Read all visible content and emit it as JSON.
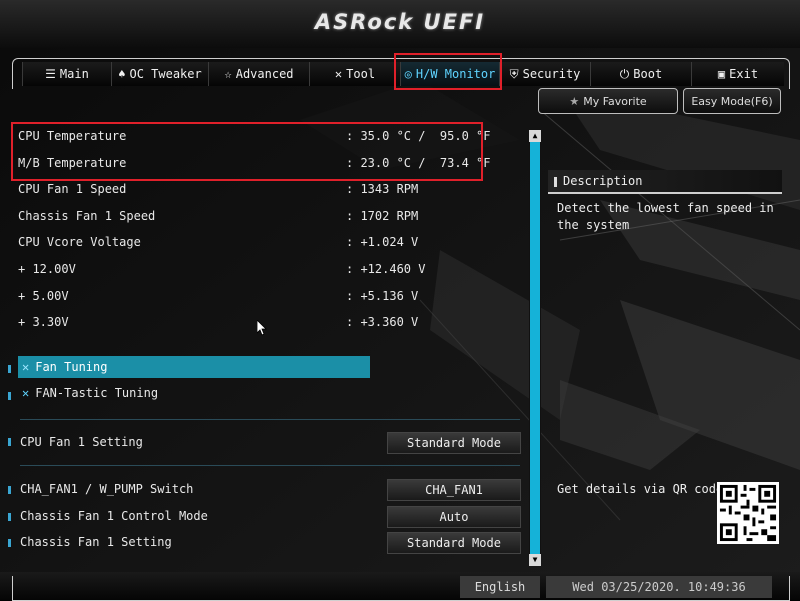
{
  "header": {
    "title": "ASRock UEFI"
  },
  "tabs": [
    {
      "label": "Main",
      "icon": "list-icon",
      "glyph": "☰"
    },
    {
      "label": "OC Tweaker",
      "icon": "flame-icon",
      "glyph": "♠"
    },
    {
      "label": "Advanced",
      "icon": "star-icon",
      "glyph": "☆"
    },
    {
      "label": "Tool",
      "icon": "tool-icon",
      "glyph": "✕"
    },
    {
      "label": "H/W Monitor",
      "icon": "monitor-icon",
      "glyph": "◎"
    },
    {
      "label": "Security",
      "icon": "shield-icon",
      "glyph": "⛨"
    },
    {
      "label": "Boot",
      "icon": "power-icon",
      "glyph": "⏻"
    },
    {
      "label": "Exit",
      "icon": "exit-icon",
      "glyph": "▣"
    }
  ],
  "buttons": {
    "favorite": "My Favorite",
    "easy_mode": "Easy Mode(F6)"
  },
  "readings": [
    {
      "label": "CPU Temperature",
      "value": ": 35.0 °C /  95.0 °F"
    },
    {
      "label": "M/B Temperature",
      "value": ": 23.0 °C /  73.4 °F"
    },
    {
      "label": "CPU Fan 1 Speed",
      "value": ": 1343 RPM"
    },
    {
      "label": "Chassis Fan 1 Speed",
      "value": ": 1702 RPM"
    },
    {
      "label": "CPU Vcore Voltage",
      "value": ": +1.024 V"
    },
    {
      "label": "+ 12.00V",
      "value": ": +12.460 V"
    },
    {
      "label": "+ 5.00V",
      "value": ": +5.136 V"
    },
    {
      "label": "+ 3.30V",
      "value": ": +3.360 V"
    }
  ],
  "menu": {
    "fan_tuning": "Fan Tuning",
    "fan_tastic": "FAN-Tastic Tuning"
  },
  "settings": [
    {
      "label": "CPU Fan 1 Setting",
      "value": "Standard Mode"
    },
    {
      "label": "CHA_FAN1 / W_PUMP Switch",
      "value": "CHA_FAN1"
    },
    {
      "label": "Chassis Fan 1 Control Mode",
      "value": "Auto"
    },
    {
      "label": "Chassis Fan 1 Setting",
      "value": "Standard Mode"
    }
  ],
  "description": {
    "title": "Description",
    "text": "Detect the lowest fan speed in the system",
    "qr_label": "Get details via QR code"
  },
  "footer": {
    "language": "English",
    "datetime": "Wed 03/25/2020. 10:49:36"
  },
  "colors": {
    "accent": "#1b8fa7",
    "highlight": "#e0202a",
    "active_tab": "#5fd4ff"
  }
}
